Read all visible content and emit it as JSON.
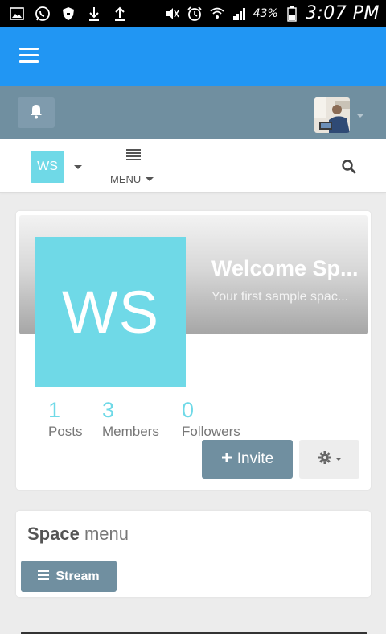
{
  "status_bar": {
    "battery_percent": "43%",
    "time": "3:07 PM",
    "icons": [
      "gallery-icon",
      "whatsapp-icon",
      "shield-icon",
      "download-icon",
      "upload-icon",
      "mute-icon",
      "alarm-icon",
      "wifi-icon",
      "signal-icon",
      "battery-icon"
    ]
  },
  "colors": {
    "top_bar": "#2196f3",
    "user_bar": "#708fa0",
    "space_accent": "#6fd9e7",
    "button": "#708fa0"
  },
  "space_nav": {
    "chip_label": "WS",
    "menu_label": "MENU"
  },
  "space": {
    "initials": "WS",
    "title": "Welcome Sp...",
    "description": "Your first sample spac...",
    "stats": [
      {
        "number": "1",
        "label": "Posts"
      },
      {
        "number": "3",
        "label": "Members"
      },
      {
        "number": "0",
        "label": "Followers"
      }
    ],
    "invite_label": "Invite"
  },
  "space_menu": {
    "title_bold": "Space",
    "title_light": "menu",
    "items": [
      {
        "label": "Stream"
      }
    ]
  }
}
